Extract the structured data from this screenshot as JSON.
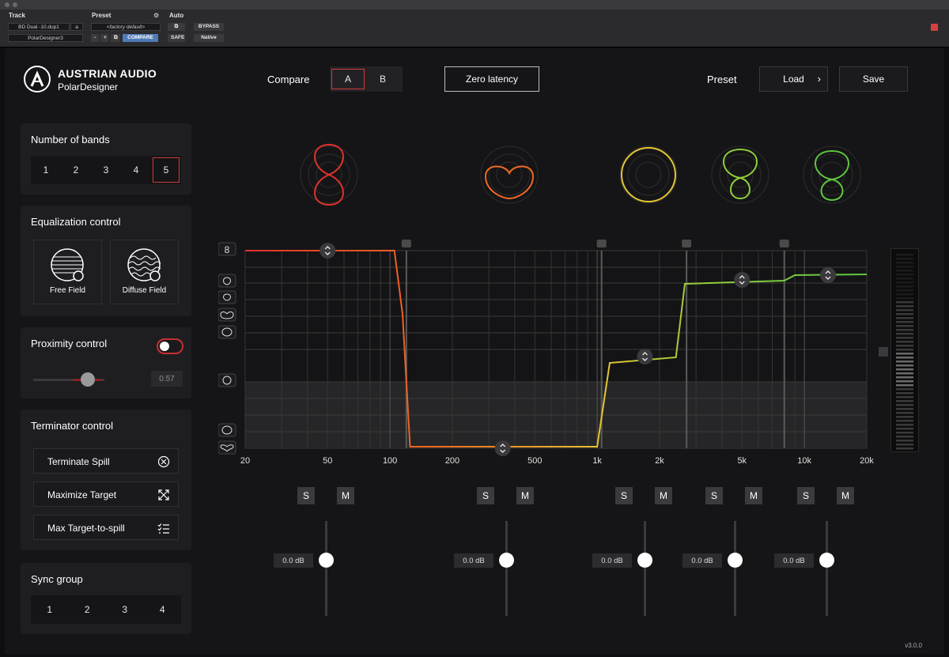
{
  "host": {
    "track_label": "Track",
    "preset_label": "Preset",
    "auto_label": "Auto",
    "track_name": "BD Dual -10.dup1",
    "track_channel": "a",
    "plugin_name": "PolarDesigner3",
    "preset_value": "<factory default>",
    "compare_label": "COMPARE",
    "bypass_label": "BYPASS",
    "safe_label": "SAFE",
    "native_label": "Native",
    "minus_label": "-",
    "plus_label": "+"
  },
  "brand": {
    "title": "AUSTRIAN AUDIO",
    "subtitle": "PolarDesigner"
  },
  "top": {
    "compare_label": "Compare",
    "compare_options": [
      "A",
      "B"
    ],
    "compare_selected": "A",
    "zero_latency": "Zero latency",
    "preset_label": "Preset",
    "load_label": "Load",
    "save_label": "Save"
  },
  "bands_panel": {
    "title": "Number of bands",
    "options": [
      "1",
      "2",
      "3",
      "4",
      "5"
    ],
    "selected": "5"
  },
  "eq_panel": {
    "title": "Equalization control",
    "free_field": "Free Field",
    "diffuse_field": "Diffuse Field"
  },
  "proximity_panel": {
    "title": "Proximity control",
    "enabled": true,
    "value": "0.57"
  },
  "terminator_panel": {
    "title": "Terminator control",
    "items": [
      {
        "label": "Terminate Spill",
        "icon": "circle-x-icon"
      },
      {
        "label": "Maximize Target",
        "icon": "expand-arrows-icon"
      },
      {
        "label": "Max Target-to-spill",
        "icon": "checklist-icon"
      }
    ]
  },
  "sync_panel": {
    "title": "Sync group",
    "options": [
      "1",
      "2",
      "3",
      "4"
    ]
  },
  "graph": {
    "x_ticks": [
      "20",
      "50",
      "100",
      "200",
      "500",
      "1k",
      "2k",
      "5k",
      "10k",
      "20k"
    ],
    "band_colors": [
      "#e0322a",
      "#ef6a22",
      "#e6c633",
      "#8fcf3a",
      "#5fc540"
    ],
    "band_patterns": [
      "figure-8",
      "hypercardioid",
      "omni",
      "cardioid-8",
      "cardioid-8"
    ]
  },
  "bands": [
    {
      "solo": "S",
      "mute": "M",
      "gain": "0.0 dB"
    },
    {
      "solo": "S",
      "mute": "M",
      "gain": "0.0 dB"
    },
    {
      "solo": "S",
      "mute": "M",
      "gain": "0.0 dB"
    },
    {
      "solo": "S",
      "mute": "M",
      "gain": "0.0 dB"
    },
    {
      "solo": "S",
      "mute": "M",
      "gain": "0.0 dB"
    }
  ],
  "version": "v3.0.0"
}
